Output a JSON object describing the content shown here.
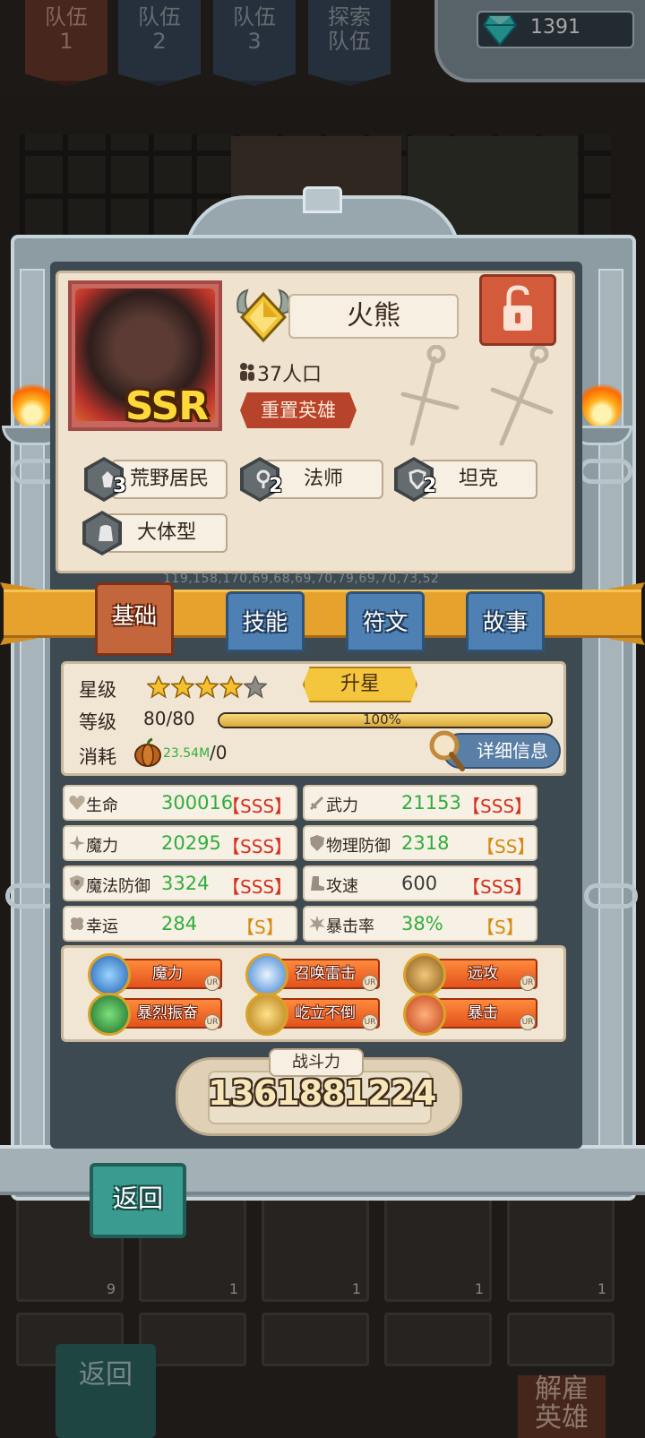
{
  "header": {
    "team_tabs": [
      {
        "label": "队伍\n1",
        "active": true
      },
      {
        "label": "队伍\n2",
        "active": false
      },
      {
        "label": "队伍\n3",
        "active": false
      },
      {
        "label": "探索\n队伍",
        "active": false
      }
    ],
    "gems": "1391",
    "gem_icon": "diamond-icon"
  },
  "hero": {
    "rarity": "SSR",
    "name": "火熊",
    "population": "37人口",
    "reset_label": "重置英雄",
    "lock_icon": "unlock-icon",
    "traits": [
      {
        "count": "3",
        "label": "荒野居民",
        "icon": "wild-tribe-icon"
      },
      {
        "count": "2",
        "label": "法师",
        "icon": "mage-icon"
      },
      {
        "count": "2",
        "label": "坦克",
        "icon": "shield-icon"
      },
      {
        "count": "",
        "label": "大体型",
        "icon": "large-body-icon"
      }
    ],
    "debug_numbers": "119,158,170,69,68,69,70,79,69,70,73,52"
  },
  "tabs": [
    {
      "label": "基础",
      "active": true
    },
    {
      "label": "技能",
      "active": false
    },
    {
      "label": "符文",
      "active": false
    },
    {
      "label": "故事",
      "active": false
    }
  ],
  "basic": {
    "star_label": "星级",
    "stars_filled": 4,
    "stars_total": 5,
    "upstar_label": "升星",
    "level_label": "等级",
    "level_value": "80/80",
    "level_progress": 1.0,
    "level_percent": "100%",
    "cost_label": "消耗",
    "cost_value": "23.54M",
    "cost_max": "/0",
    "detail_label": "详细信息"
  },
  "stats": [
    {
      "name": "生命",
      "value": "300016",
      "grade": "【SSS】",
      "icon": "heart-icon"
    },
    {
      "name": "武力",
      "value": "21153",
      "grade": "【SSS】",
      "icon": "sword-icon"
    },
    {
      "name": "魔力",
      "value": "20295",
      "grade": "【SSS】",
      "icon": "sparkle-icon"
    },
    {
      "name": "物理防御",
      "value": "2318",
      "grade": "【SS】",
      "icon": "shield-icon"
    },
    {
      "name": "魔法防御",
      "value": "3324",
      "grade": "【SSS】",
      "icon": "magic-shield-icon"
    },
    {
      "name": "攻速",
      "value": "600",
      "grade": "【SSS】",
      "icon": "boot-icon"
    },
    {
      "name": "幸运",
      "value": "284",
      "grade": "【S】",
      "icon": "clover-icon"
    },
    {
      "name": "暴击率",
      "value": "38%",
      "grade": "【S】",
      "icon": "burst-icon"
    }
  ],
  "skills": [
    {
      "label": "魔力",
      "icon": "magic-book-icon",
      "tag": "UR"
    },
    {
      "label": "召唤雷击",
      "icon": "lightning-icon",
      "tag": "UR"
    },
    {
      "label": "远攻",
      "icon": "bow-icon",
      "tag": "UR"
    },
    {
      "label": "暴烈振奋",
      "icon": "rage-icon",
      "tag": "UR"
    },
    {
      "label": "屹立不倒",
      "icon": "stand-icon",
      "tag": "UR"
    },
    {
      "label": "暴击",
      "icon": "critical-icon",
      "tag": "UR"
    }
  ],
  "power": {
    "label": "战斗力",
    "value": "1361881224"
  },
  "footer": {
    "return_label": "返回",
    "bg_return_label": "返回",
    "bg_dismiss_label": "解雇\n英雄",
    "bg_card_counts": [
      "9",
      "1",
      "1",
      "1",
      "1"
    ]
  },
  "colors": {
    "accent_gold": "#e6a22c",
    "stat_value_green": "#2fae3c",
    "grade_red": "#d5301e",
    "grade_gold": "#d78a12",
    "tab_blue": "#4e80b4",
    "tab_active": "#c3663c"
  }
}
